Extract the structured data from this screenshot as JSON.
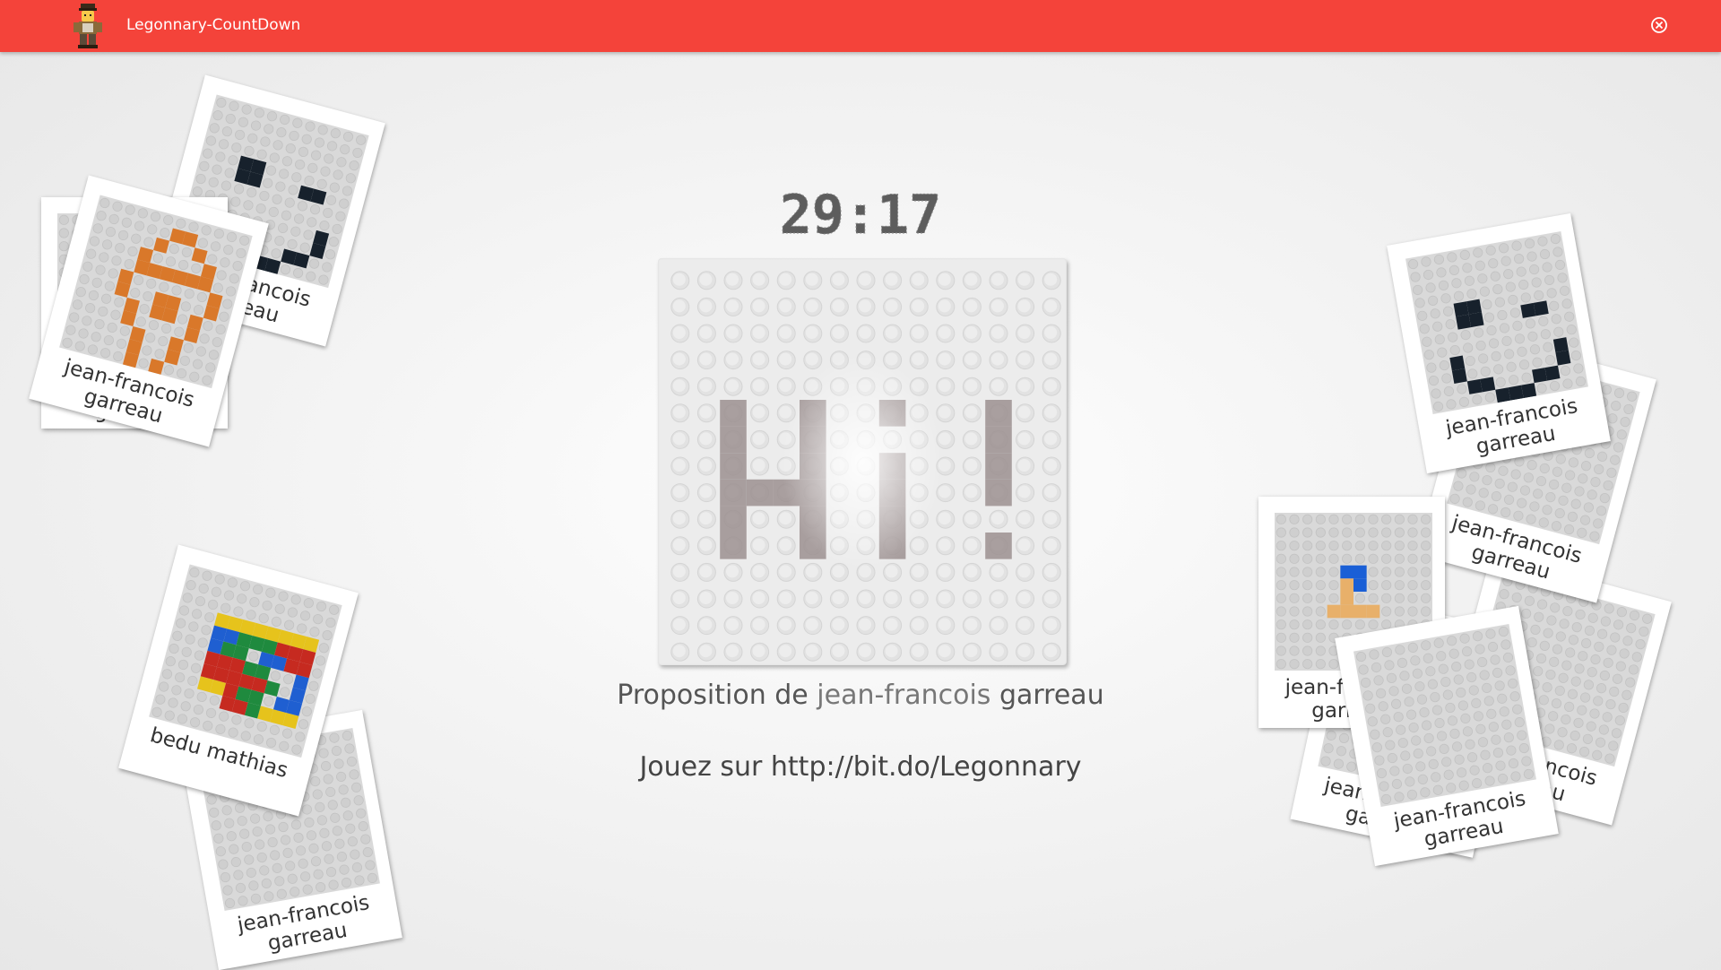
{
  "app": {
    "title": "Legonnary-CountDown",
    "bar_color": "#f4433a",
    "logo_icon": "lego-minifigure-logo",
    "close_icon": "close-circle-icon"
  },
  "timer": {
    "text": "29:17"
  },
  "proposal": {
    "prefix": "Proposition de ",
    "author_first": "jean-francois",
    "author_last": " garreau"
  },
  "playon": {
    "text": "Jouez sur http://bit.do/Legonnary"
  },
  "board_letters": "Hi!",
  "polaroids": [
    {
      "caption": "jean-francois garreau",
      "artwork": "smiley"
    },
    {
      "caption": "jean-francois garreau",
      "artwork": "blank"
    },
    {
      "caption": "jean-francois garreau",
      "artwork": "orange-logo"
    },
    {
      "caption": "bedu mathias",
      "artwork": "color-bricks"
    },
    {
      "caption": "jean-francois garreau",
      "artwork": "blank"
    },
    {
      "caption": "jean-francois garreau",
      "artwork": "smiley"
    },
    {
      "caption": "jean-francois garreau",
      "artwork": "blank"
    },
    {
      "caption": "jean-francois garreau",
      "artwork": "blank"
    },
    {
      "caption": "jean-francois garreau",
      "artwork": "figure-small"
    },
    {
      "caption": "jean-francois garreau",
      "artwork": "blank"
    },
    {
      "caption": "jean-francois garreau",
      "artwork": "blank"
    }
  ]
}
